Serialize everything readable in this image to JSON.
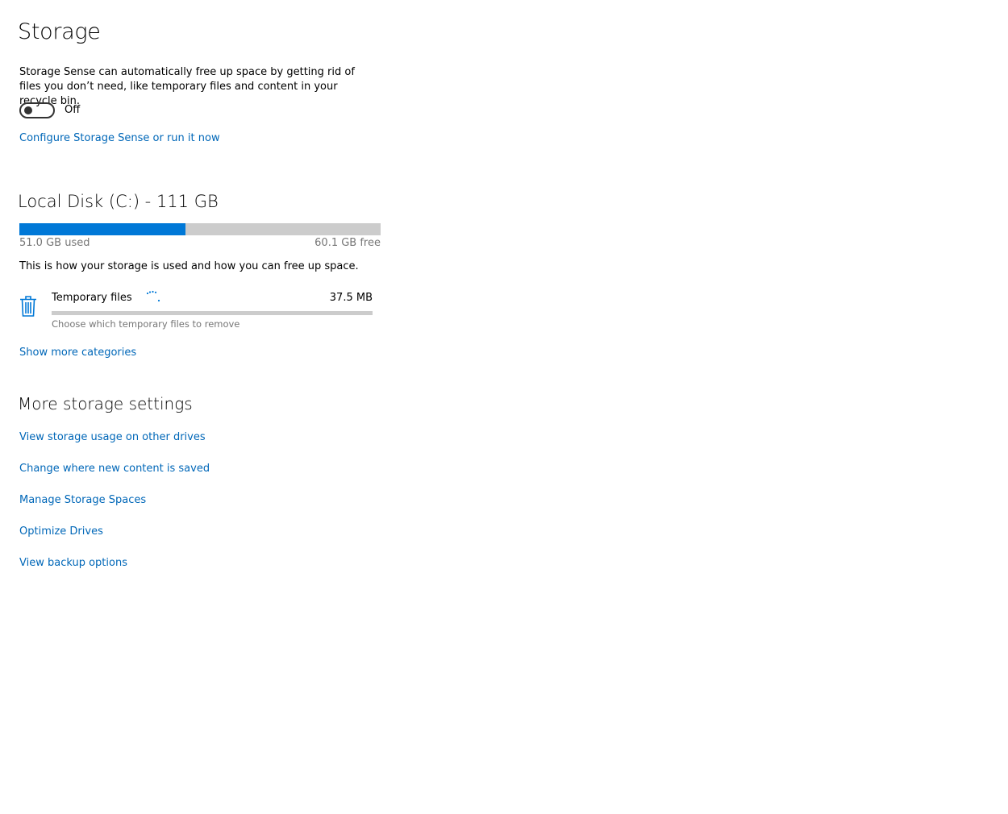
{
  "page": {
    "title": "Storage",
    "description": "Storage Sense can automatically free up space by getting rid of files you don’t need, like temporary files and content in your recycle bin.",
    "storage_sense_toggle": {
      "state_label": "Off",
      "on": false
    },
    "configure_link": "Configure Storage Sense or run it now"
  },
  "disk": {
    "heading": "Local Disk (C:) - 111 GB",
    "used_label": "51.0 GB used",
    "free_label": "60.1 GB free",
    "used_fraction": 0.46,
    "usage_text": "This is how your storage is used and how you can free up space.",
    "categories": [
      {
        "name": "Temporary files",
        "size": "37.5 MB",
        "subtitle": "Choose which temporary files to remove",
        "icon": "trash-icon",
        "loading": true,
        "fraction": 0.0
      }
    ],
    "show_more_link": "Show more categories"
  },
  "more_settings": {
    "heading": "More storage settings",
    "links": [
      "View storage usage on other drives",
      "Change where new content is saved",
      "Manage Storage Spaces",
      "Optimize Drives",
      "View backup options"
    ]
  },
  "colors": {
    "accent": "#0078d7",
    "link": "#0067b8",
    "bar_background": "#cccccc",
    "muted_text": "#767676"
  }
}
